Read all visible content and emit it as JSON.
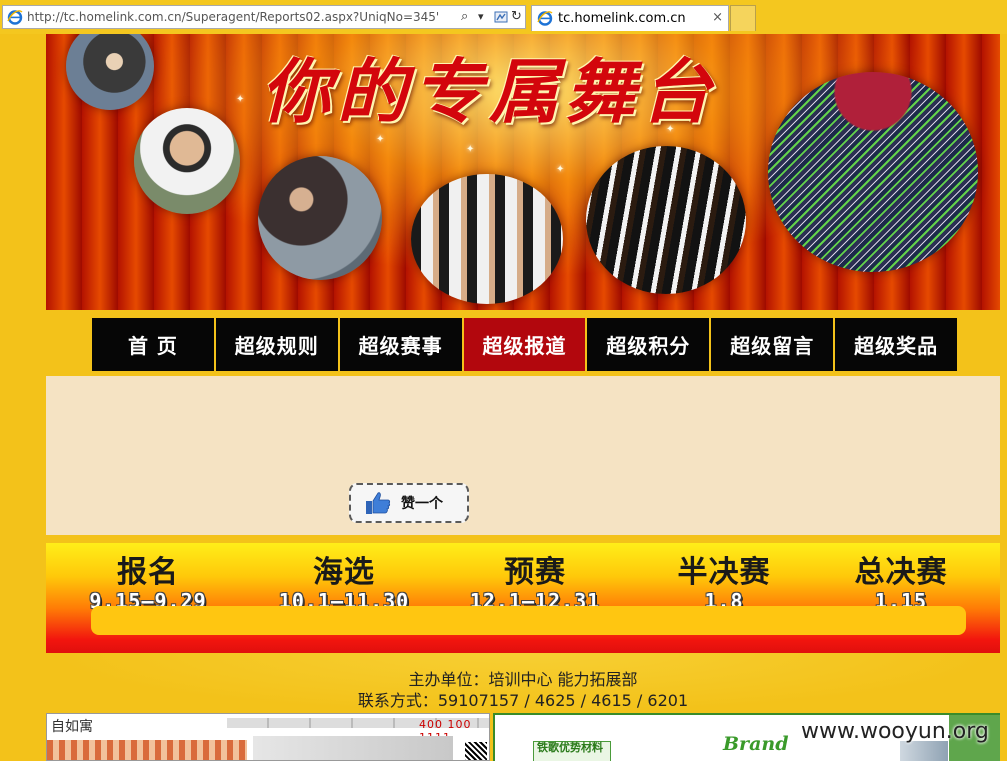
{
  "browser": {
    "address_url": "http://tc.homelink.com.cn/Superagent/Reports02.aspx?UniqNo=345'",
    "tab_title": "tc.homelink.com.cn",
    "tab_close": "×",
    "search_glyph": "⌕",
    "dropdown_glyph": "▾",
    "refresh_glyph": "↻"
  },
  "banner": {
    "title": "你的专属舞台"
  },
  "nav": {
    "items": [
      {
        "label": "首 页"
      },
      {
        "label": "超级规则"
      },
      {
        "label": "超级赛事"
      },
      {
        "label": "超级报道",
        "active": true
      },
      {
        "label": "超级积分"
      },
      {
        "label": "超级留言"
      },
      {
        "label": "超级奖品"
      }
    ],
    "active_color": "#b2070d",
    "item_color": "#060606"
  },
  "content": {
    "like_label": "赞一个"
  },
  "schedule": {
    "stages": [
      {
        "name": "报名",
        "date": "9.15—9.29"
      },
      {
        "name": "海选",
        "date": "10.1—11.30"
      },
      {
        "name": "预赛",
        "date": "12.1—12.31"
      },
      {
        "name": "半决赛",
        "date": "1.8"
      },
      {
        "name": "总决赛",
        "date": "1.15"
      }
    ],
    "progress_fraction": 0
  },
  "footer": {
    "organizer": "主办单位：培训中心 能力拓展部",
    "contact": "联系方式：59107157 / 4625 / 4615 / 6201"
  },
  "ads": {
    "left_brand": "自如寓",
    "left_phone": "400 100 1111",
    "right_green_text": "铁歌优势材料",
    "right_logo": "Brand",
    "watermark": "www.wooyun.org"
  },
  "colors": {
    "page_bg": "#f3c21a",
    "content_bg": "#f5e3c3",
    "title_red": "#d3060c"
  }
}
